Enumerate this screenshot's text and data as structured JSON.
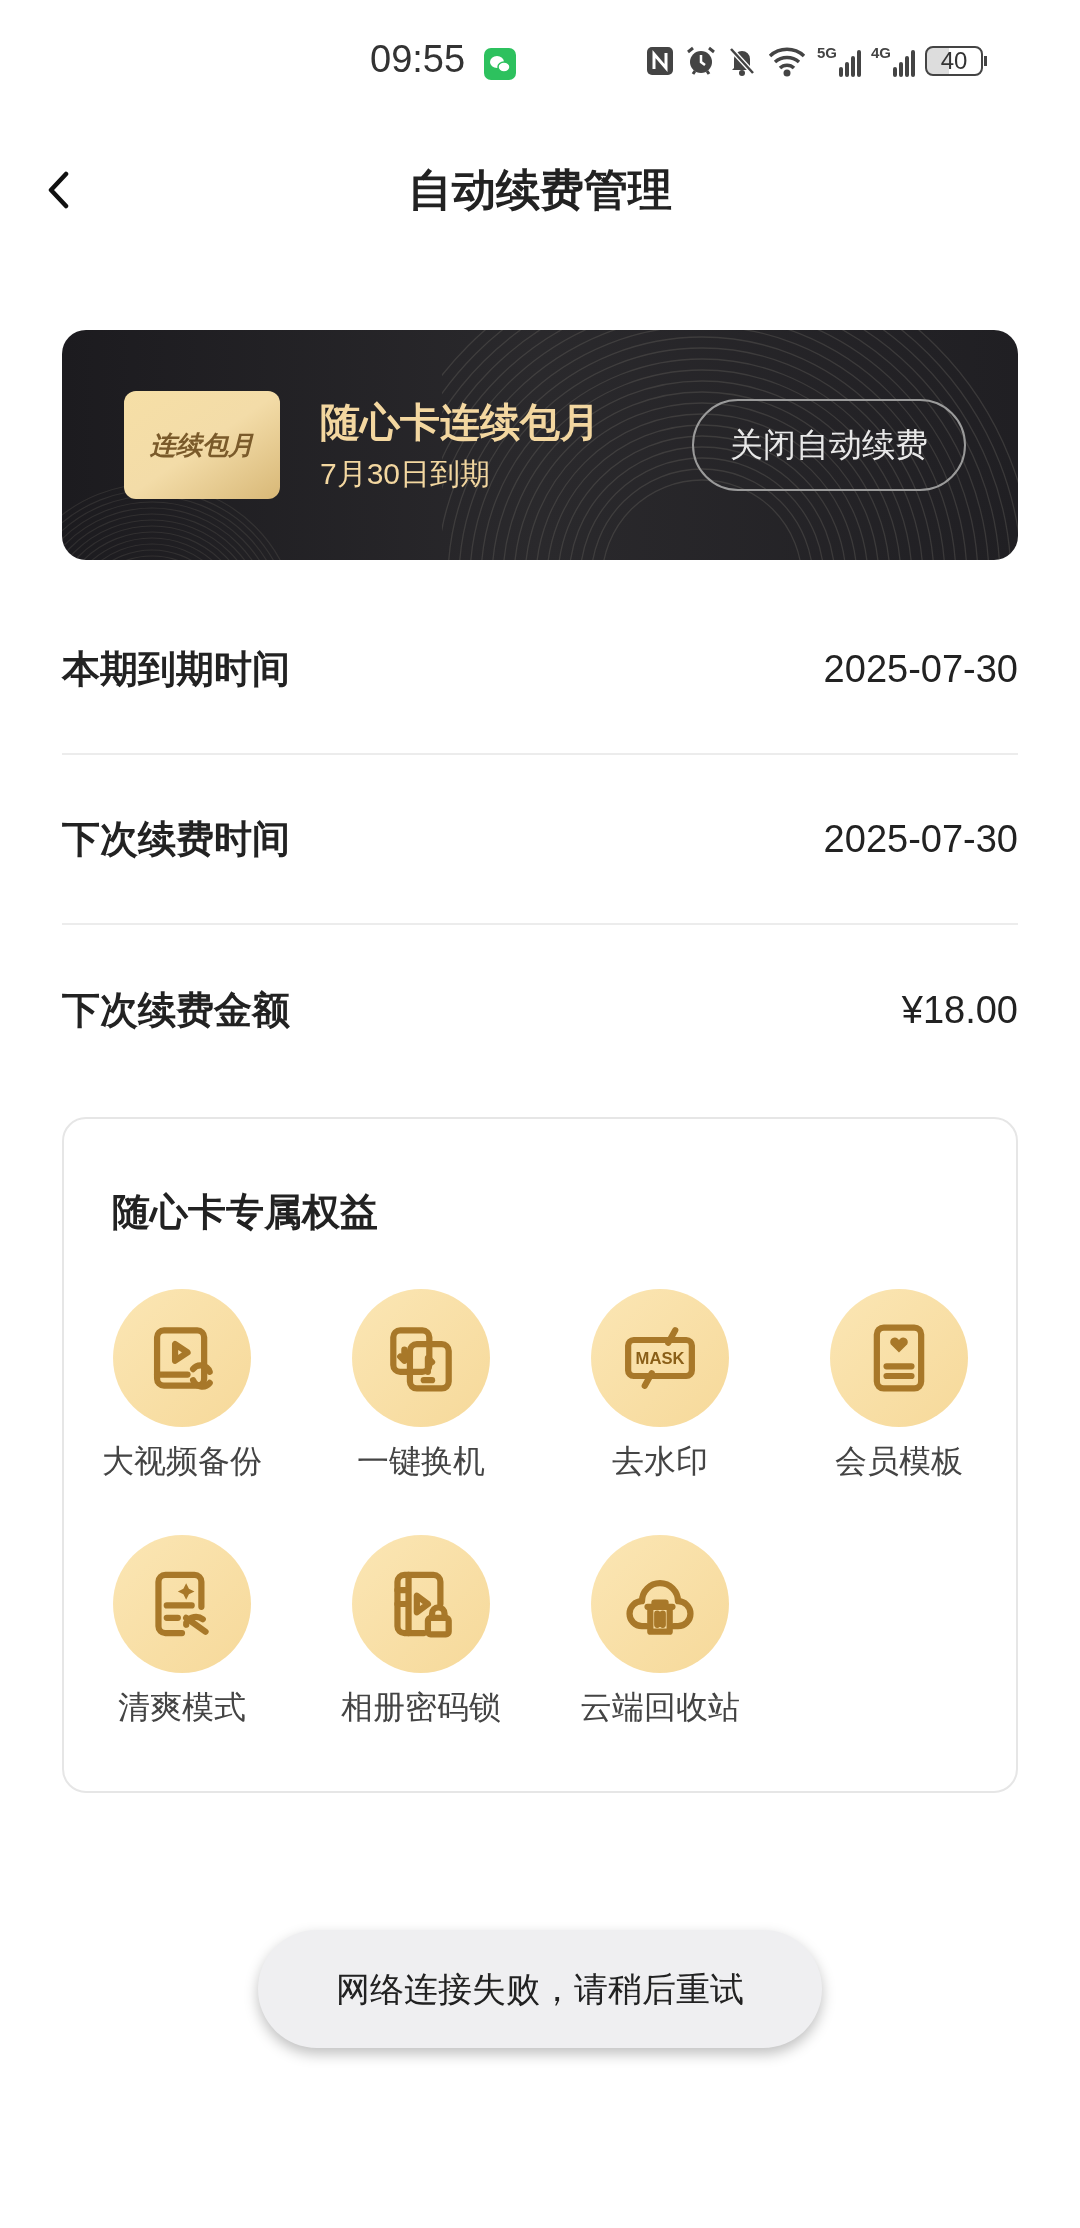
{
  "status_bar": {
    "time": "09:55",
    "battery": "40",
    "signal_1": "5G",
    "signal_2": "4G"
  },
  "header": {
    "title": "自动续费管理"
  },
  "plan_card": {
    "badge": "连续包月",
    "title": "随心卡连续包月",
    "subtitle": "7月30日到期",
    "button": "关闭自动续费"
  },
  "details": [
    {
      "label": "本期到期时间",
      "value": "2025-07-30"
    },
    {
      "label": "下次续费时间",
      "value": "2025-07-30"
    },
    {
      "label": "下次续费金额",
      "value": "¥18.00"
    }
  ],
  "benefits": {
    "title": "随心卡专属权益",
    "items": [
      {
        "kind": "video",
        "label": "大视频备份"
      },
      {
        "kind": "swap",
        "label": "一键换机"
      },
      {
        "kind": "mask",
        "label": "去水印",
        "icon_text": "MASK"
      },
      {
        "kind": "template",
        "label": "会员模板"
      },
      {
        "kind": "clean",
        "label": "清爽模式"
      },
      {
        "kind": "album",
        "label": "相册密码锁"
      },
      {
        "kind": "cloud",
        "label": "云端回收站"
      }
    ]
  },
  "toast": "网络连接失败，请稍后重试"
}
